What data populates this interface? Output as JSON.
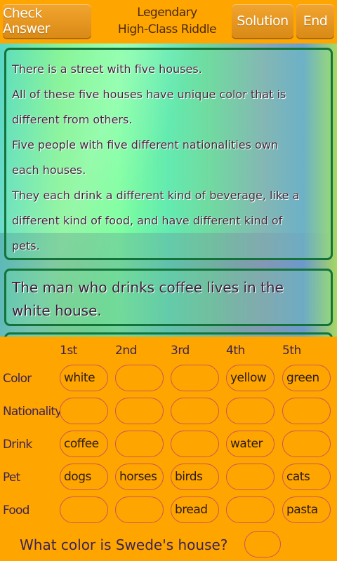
{
  "toolbar": {
    "check_label": "Check Answer",
    "title_line1": "Legendary",
    "title_line2": "High-Class Riddle",
    "solution_label": "Solution",
    "end_label": "End"
  },
  "story": {
    "lines": [
      "There is a street with five houses.",
      "All of these five houses have unique color that is",
      "different from others.",
      "Five people with five different nationalities own",
      "each houses.",
      "They each drink a different kind of beverage, like a",
      "different kind of food, and have different kind of",
      "pets."
    ]
  },
  "clue": {
    "line1": "The man who drinks coffee lives in the",
    "line2": "white house."
  },
  "grid": {
    "columns": [
      "1st",
      "2nd",
      "3rd",
      "4th",
      "5th"
    ],
    "rows": [
      {
        "label": "Color",
        "cells": [
          "white",
          "",
          "",
          "yellow",
          "green"
        ]
      },
      {
        "label": "Nationality",
        "cells": [
          "",
          "",
          "",
          "",
          ""
        ]
      },
      {
        "label": "Drink",
        "cells": [
          "coffee",
          "",
          "",
          "water",
          ""
        ]
      },
      {
        "label": "Pet",
        "cells": [
          "dogs",
          "horses",
          "birds",
          "",
          "cats"
        ]
      },
      {
        "label": "Food",
        "cells": [
          "",
          "",
          "bread",
          "",
          "pasta"
        ]
      }
    ]
  },
  "question": {
    "text": "What color is Swede's house?",
    "answer": ""
  }
}
